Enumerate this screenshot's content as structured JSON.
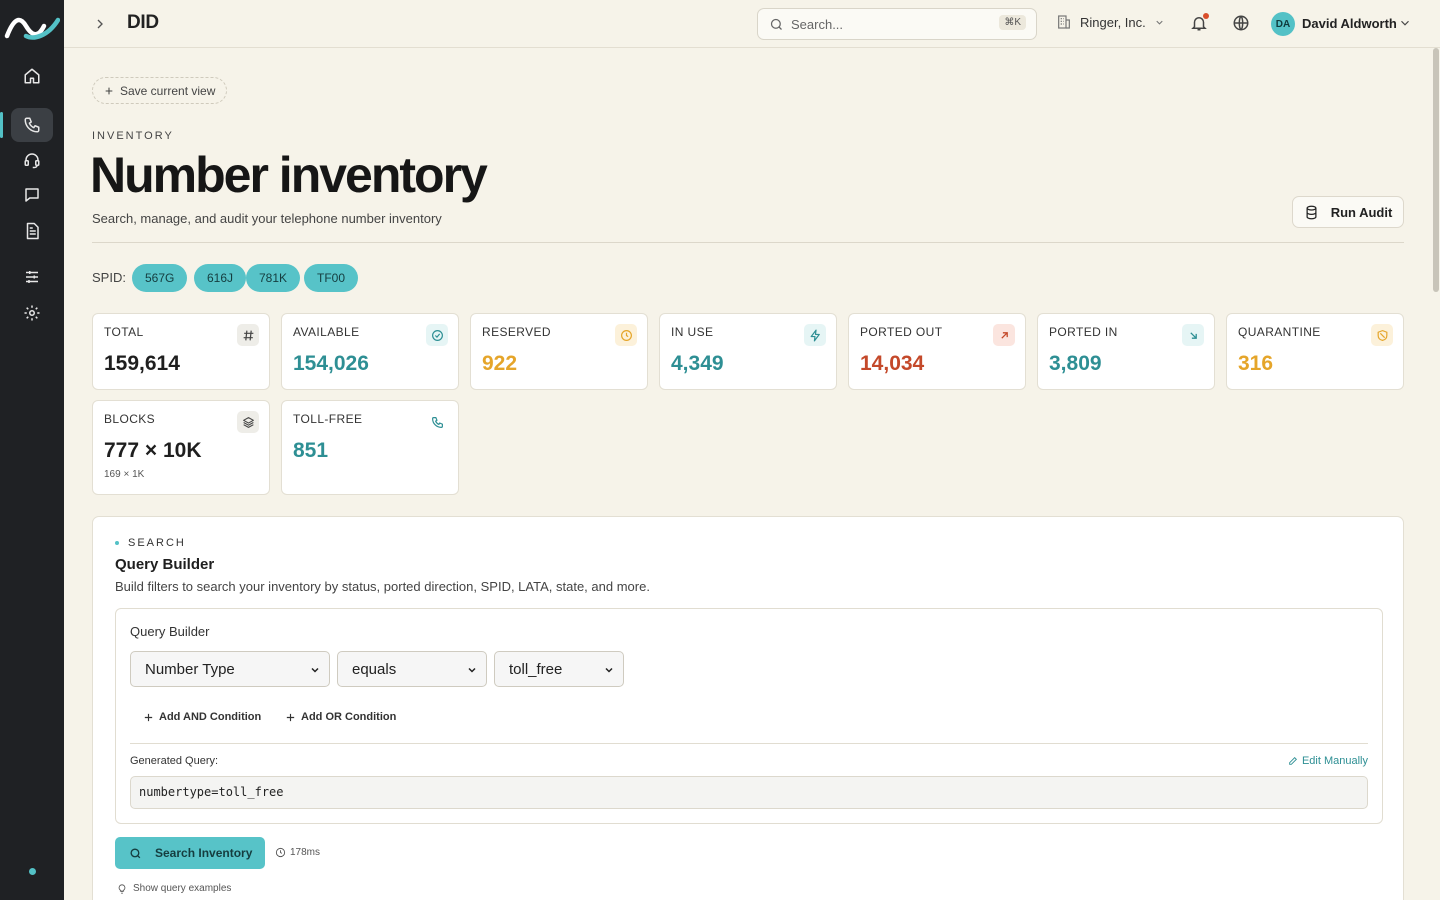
{
  "topbar": {
    "page_crumb": "DID",
    "search_placeholder": "Search...",
    "search_shortcut": "⌘K",
    "org_name": "Ringer, Inc.",
    "user_initials": "DA",
    "user_name": "David Aldworth"
  },
  "sidebar": {
    "items": [
      {
        "name": "home",
        "icon": "home-icon",
        "active": false
      },
      {
        "name": "phone",
        "icon": "phone-icon",
        "active": true
      },
      {
        "name": "support",
        "icon": "headset-icon",
        "active": false
      },
      {
        "name": "messages",
        "icon": "message-icon",
        "active": false
      },
      {
        "name": "documents",
        "icon": "document-icon",
        "active": false
      },
      {
        "name": "filters",
        "icon": "sliders-icon",
        "active": false
      },
      {
        "name": "settings",
        "icon": "gear-icon",
        "active": false
      }
    ]
  },
  "header": {
    "save_view_label": "Save current view",
    "eyebrow": "INVENTORY",
    "title": "Number inventory",
    "subtitle": "Search, manage, and audit your telephone number inventory",
    "run_audit_label": "Run Audit"
  },
  "spid": {
    "label": "SPID:",
    "chips": [
      "567G",
      "616J",
      "781K",
      "TF00"
    ]
  },
  "stats": [
    {
      "label": "TOTAL",
      "value": "159,614",
      "color": "#1f1f1f",
      "icon": "hash-icon"
    },
    {
      "label": "AVAILABLE",
      "value": "154,026",
      "color": "#2e8f94",
      "icon": "check-circle-icon"
    },
    {
      "label": "RESERVED",
      "value": "922",
      "color": "#e5a52a",
      "icon": "clock-icon"
    },
    {
      "label": "IN USE",
      "value": "4,349",
      "color": "#2e8f94",
      "icon": "bolt-icon"
    },
    {
      "label": "PORTED OUT",
      "value": "14,034",
      "color": "#c4492a",
      "icon": "arrow-up-right-icon"
    },
    {
      "label": "PORTED IN",
      "value": "3,809",
      "color": "#2e8f94",
      "icon": "arrow-down-right-icon"
    },
    {
      "label": "QUARANTINE",
      "value": "316",
      "color": "#e5a52a",
      "icon": "shield-icon"
    },
    {
      "label": "BLOCKS",
      "value": "777 × 10K",
      "sub": "169 × 1K",
      "color": "#1f1f1f",
      "icon": "layers-icon"
    },
    {
      "label": "TOLL-FREE",
      "value": "851",
      "color": "#2e8f94",
      "icon": "phone-icon"
    }
  ],
  "search": {
    "eyebrow": "SEARCH",
    "title": "Query Builder",
    "description": "Build filters to search your inventory by status, ported direction, SPID, LATA, state, and more.",
    "builder_title": "Query Builder",
    "field_select": "Number Type",
    "operator_select": "equals",
    "value_select": "toll_free",
    "add_and": "Add AND Condition",
    "add_or": "Add OR Condition",
    "generated_label": "Generated Query:",
    "edit_manually": "Edit Manually",
    "generated_query": "numbertype=toll_free",
    "search_button": "Search Inventory",
    "timing": "178ms",
    "examples_label": "Show query examples"
  },
  "colors": {
    "accent": "#53c1c6",
    "sidebar_bg": "#1f2124",
    "page_bg": "#f6f3e9"
  }
}
